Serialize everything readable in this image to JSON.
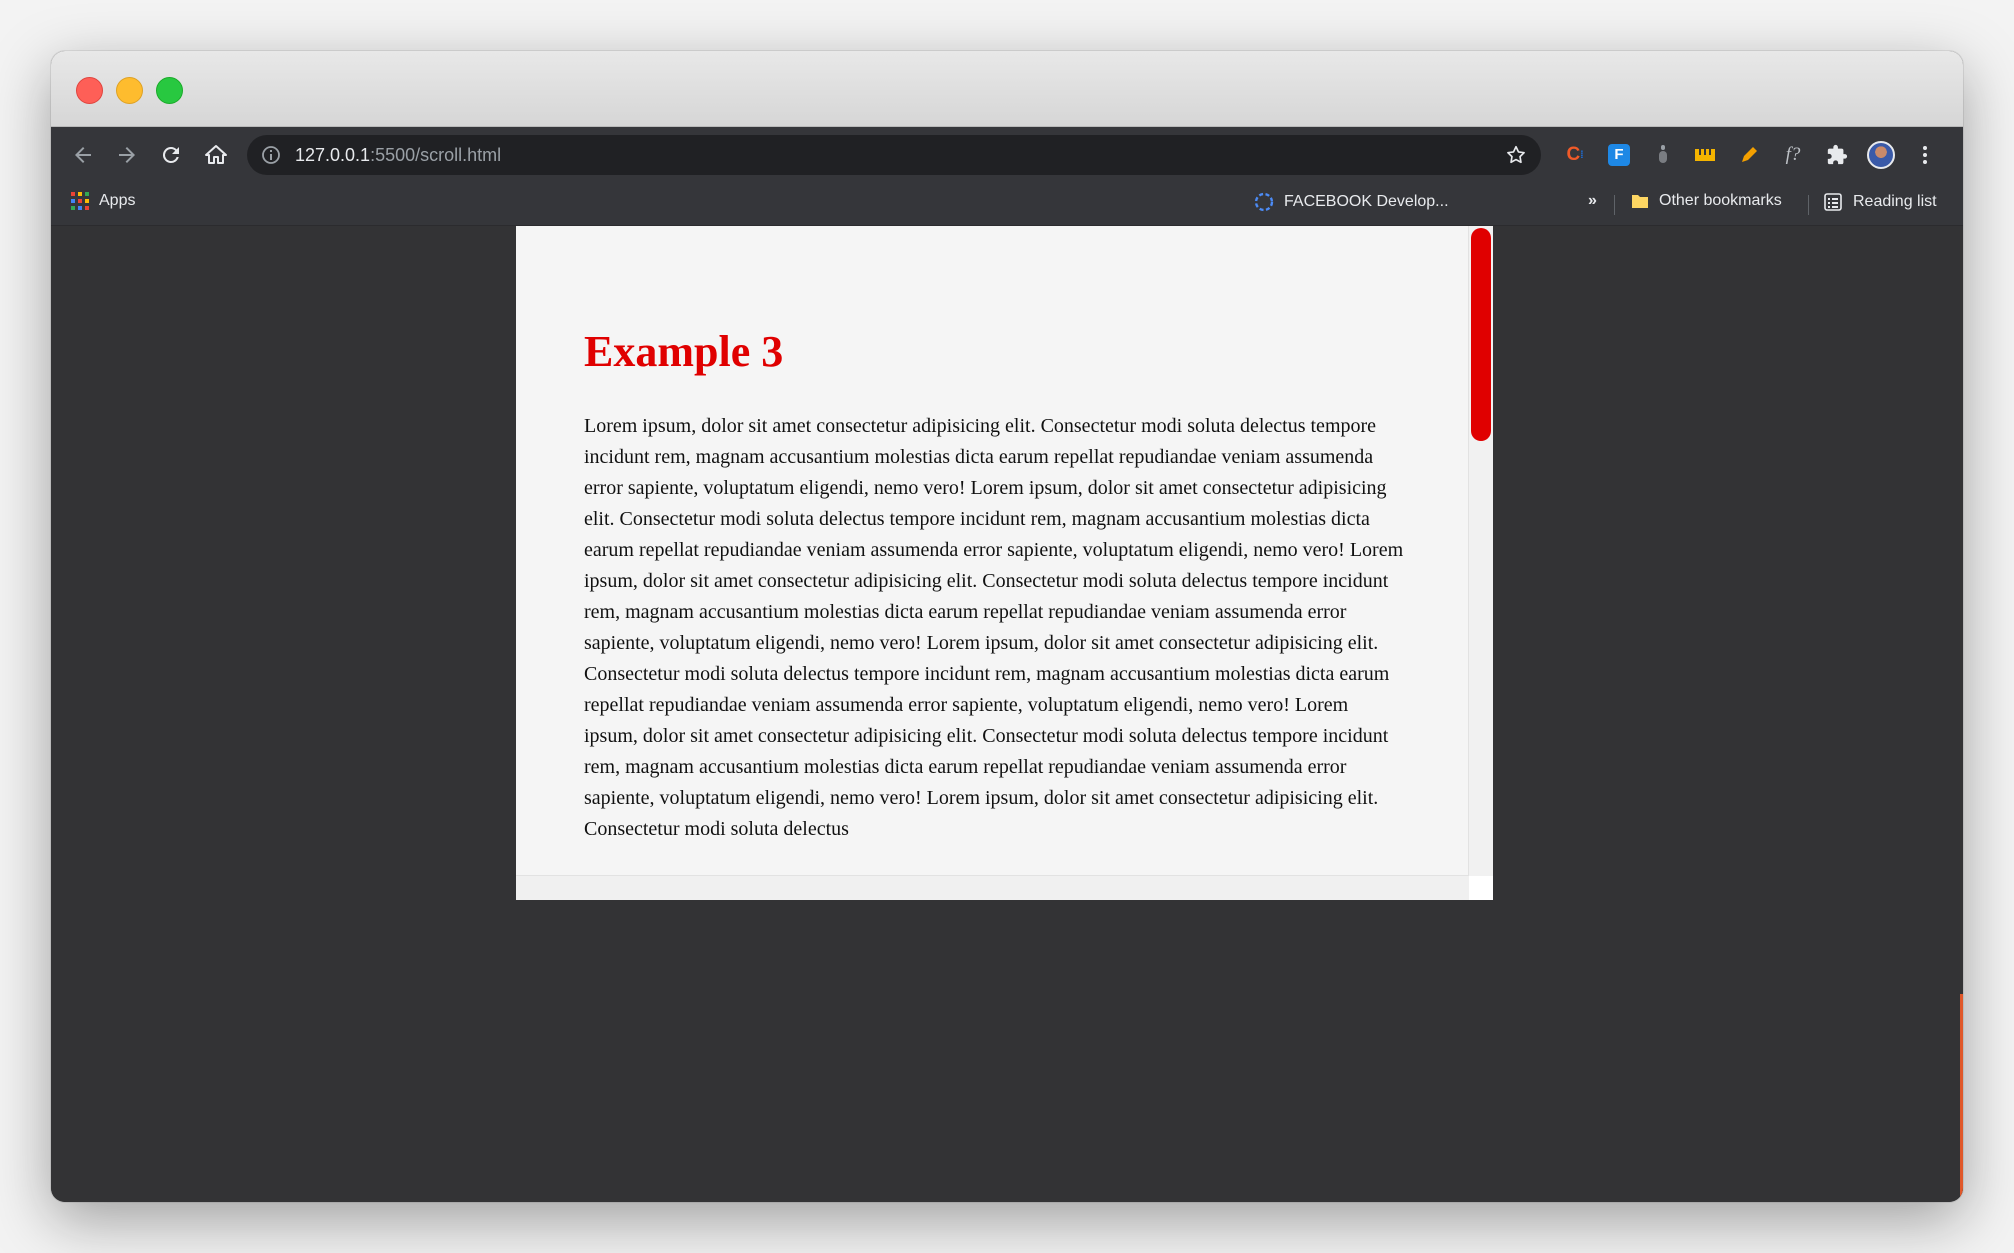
{
  "browser": {
    "url_host": "127.0.0.1",
    "url_path": ":5500/scroll.html",
    "bookmarks": {
      "apps_label": "Apps",
      "facebook_label": "FACEBOOK Develop...",
      "overflow_label": "»",
      "other_label": "Other bookmarks",
      "reading_label": "Reading list"
    },
    "extensions": {
      "ext1": "C",
      "ext2": "F",
      "ext6": "f?"
    }
  },
  "page": {
    "heading": "Example 3",
    "paragraph": "Lorem ipsum, dolor sit amet consectetur adipisicing elit. Consectetur modi soluta delectus tempore incidunt rem, magnam accusantium molestias dicta earum repellat repudiandae veniam assumenda error sapiente, voluptatum eligendi, nemo vero! Lorem ipsum, dolor sit amet consectetur adipisicing elit. Consectetur modi soluta delectus tempore incidunt rem, magnam accusantium molestias dicta earum repellat repudiandae veniam assumenda error sapiente, voluptatum eligendi, nemo vero! Lorem ipsum, dolor sit amet consectetur adipisicing elit. Consectetur modi soluta delectus tempore incidunt rem, magnam accusantium molestias dicta earum repellat repudiandae veniam assumenda error sapiente, voluptatum eligendi, nemo vero! Lorem ipsum, dolor sit amet consectetur adipisicing elit. Consectetur modi soluta delectus tempore incidunt rem, magnam accusantium molestias dicta earum repellat repudiandae veniam assumenda error sapiente, voluptatum eligendi, nemo vero! Lorem ipsum, dolor sit amet consectetur adipisicing elit. Consectetur modi soluta delectus tempore incidunt rem, magnam accusantium molestias dicta earum repellat repudiandae veniam assumenda error sapiente, voluptatum eligendi, nemo vero! Lorem ipsum, dolor sit amet consectetur adipisicing elit. Consectetur modi soluta delectus",
    "scrollbar_thumb_fraction": 0.33
  },
  "colors": {
    "accent_red": "#e00000",
    "window_bg": "#333335",
    "scroll_area_bg": "#f5f5f5"
  }
}
